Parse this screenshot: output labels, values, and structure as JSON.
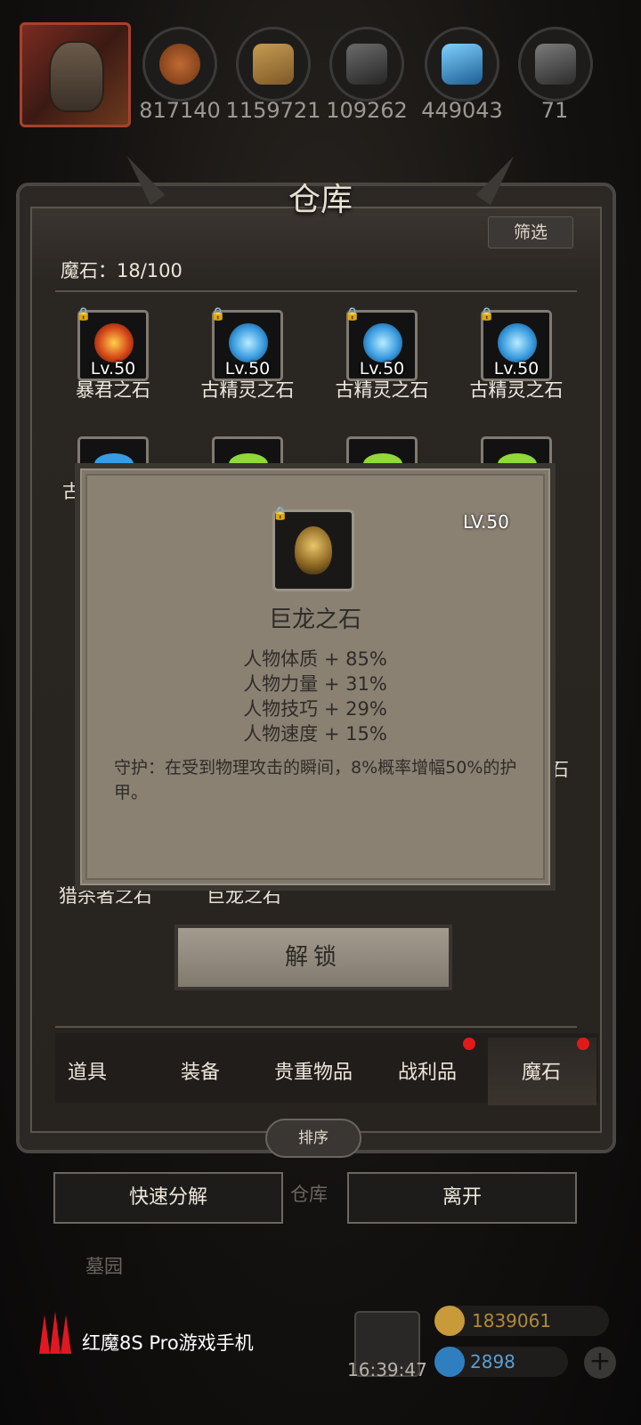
{
  "resources": [
    {
      "icon": "meat-icon",
      "value": "817140",
      "color": "#a25b2b"
    },
    {
      "icon": "wood-icon",
      "value": "1159721",
      "color": "#a07a3c"
    },
    {
      "icon": "iron-icon",
      "value": "109262",
      "color": "#4b4b4b"
    },
    {
      "icon": "crystal-icon",
      "value": "449043",
      "color": "#2c86b9"
    },
    {
      "icon": "ingot-icon",
      "value": "71",
      "color": "#5a5a5a"
    }
  ],
  "warehouse": {
    "title": "仓库",
    "filter_label": "筛选",
    "count_label": "魔石：18/100"
  },
  "grid_row1": [
    {
      "name": "暴君之石",
      "level": "Lv.50",
      "color": "#e0561c"
    },
    {
      "name": "古精灵之石",
      "level": "Lv.50",
      "color": "#4aa7e6"
    },
    {
      "name": "古精灵之石",
      "level": "Lv.50",
      "color": "#4aa7e6"
    },
    {
      "name": "古精灵之石",
      "level": "Lv.50",
      "color": "#4aa7e6"
    }
  ],
  "grid_row2_partial": [
    "古",
    "",
    "",
    ""
  ],
  "grid_row_bottom_partial": [
    "猎杀者之石",
    "巨龙之石"
  ],
  "right_clip_text": "石",
  "tooltip": {
    "level": "LV.50",
    "name": "巨龙之石",
    "stats": [
      "人物体质 + 85%",
      "人物力量 + 31%",
      "人物技巧 + 29%",
      "人物速度 + 15%"
    ],
    "description": "守护：在受到物理攻击的瞬间，8%概率增幅50%的护甲。"
  },
  "unlock_label": "解锁",
  "tabs": [
    "道具",
    "装备",
    "贵重物品",
    "战利品",
    "魔石"
  ],
  "active_tab": "魔石",
  "sort_label": "排序",
  "quick_decompose_label": "快速分解",
  "leave_label": "离开",
  "bg_text": {
    "warehouse": "仓库",
    "cemetery": "墓园"
  },
  "footer": {
    "brand": "红魔8S Pro游戏手机",
    "time": "16:39:47",
    "gold": "1839061",
    "gems": "2898"
  }
}
